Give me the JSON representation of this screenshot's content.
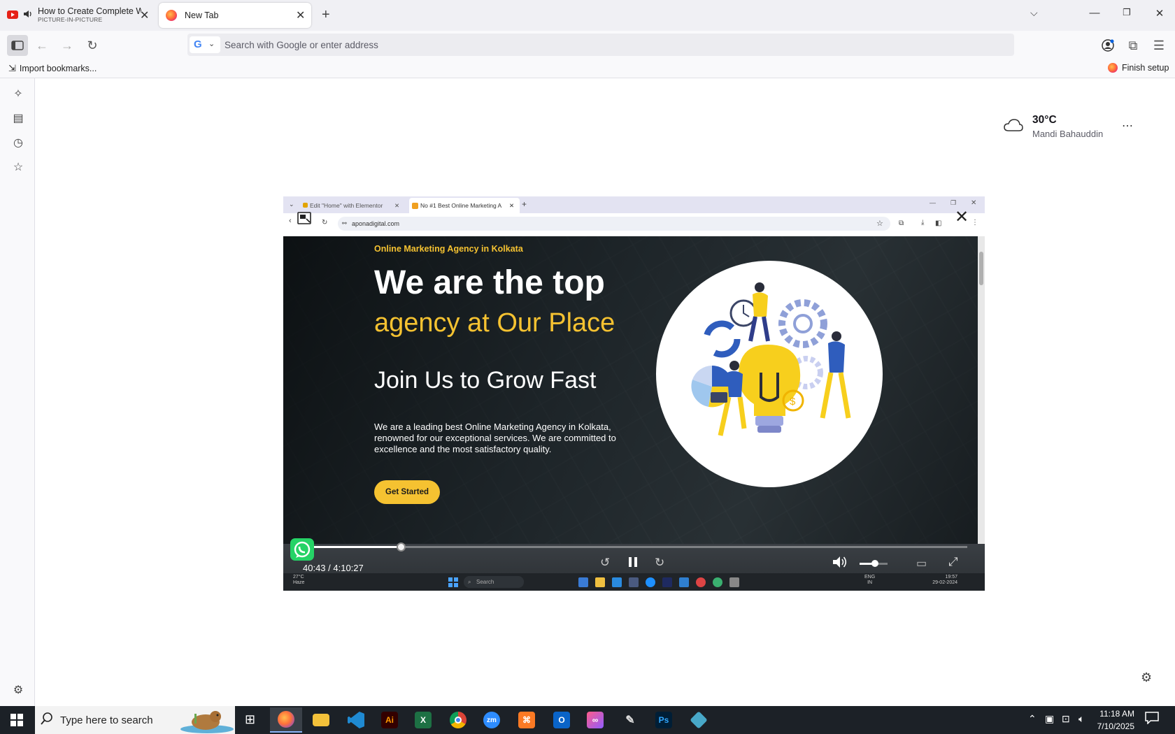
{
  "browser": {
    "tabs": [
      {
        "title": "How to Create Complete W",
        "subtitle": "PICTURE-IN-PICTURE",
        "active": false,
        "favicon": "youtube-icon"
      },
      {
        "title": "New Tab",
        "active": true,
        "favicon": "firefox-icon"
      }
    ],
    "address_bar": {
      "placeholder": "Search with Google or enter address",
      "value": "",
      "engine_icon": "google-icon"
    },
    "bookmarks": {
      "import_label": "Import bookmarks...",
      "finish_setup_label": "Finish setup"
    }
  },
  "new_tab": {
    "weather": {
      "temp": "30°C",
      "location": "Mandi Bahauddin",
      "icon": "cloud-icon"
    }
  },
  "pip": {
    "inner_tabs": [
      {
        "title": "Edit \"Home\" with Elementor"
      },
      {
        "title": "No #1 Best Online Marketing A"
      }
    ],
    "inner_url": "aponadigital.com",
    "hero": {
      "eyebrow": "Online Marketing Agency in Kolkata",
      "title_line1": "We are the top",
      "title_line2": "agency at Our Place",
      "title_line3": "Join Us to Grow Fast",
      "description": "We are a leading best Online Marketing Agency in Kolkata, renowned for our exceptional services. We are committed to excellence and the most satisfactory quality.",
      "cta_label": "Get Started"
    },
    "player": {
      "time": "40:43 / 4:10:27",
      "progress": 0.163,
      "volume": 0.55
    },
    "inner_taskbar": {
      "search_label": "Search",
      "weather": "27°C",
      "weather_sub": "Haze",
      "lang": "ENG",
      "lang_sub": "IN",
      "time": "19:57",
      "date": "29-02-2024"
    }
  },
  "taskbar": {
    "search_placeholder": "Type here to search",
    "apps": [
      {
        "name": "firefox",
        "label": ""
      },
      {
        "name": "file-explorer",
        "label": ""
      },
      {
        "name": "vscode",
        "label": ""
      },
      {
        "name": "illustrator",
        "label": "Ai"
      },
      {
        "name": "excel",
        "label": "X"
      },
      {
        "name": "chrome",
        "label": ""
      },
      {
        "name": "zoom",
        "label": "zm"
      },
      {
        "name": "xampp",
        "label": ""
      },
      {
        "name": "outlook",
        "label": "O"
      },
      {
        "name": "creative-cloud",
        "label": ""
      },
      {
        "name": "pen-tool",
        "label": ""
      },
      {
        "name": "photoshop",
        "label": "Ps"
      },
      {
        "name": "app-diamond",
        "label": ""
      }
    ],
    "clock": {
      "time": "11:18 AM",
      "date": "7/10/2025"
    }
  }
}
